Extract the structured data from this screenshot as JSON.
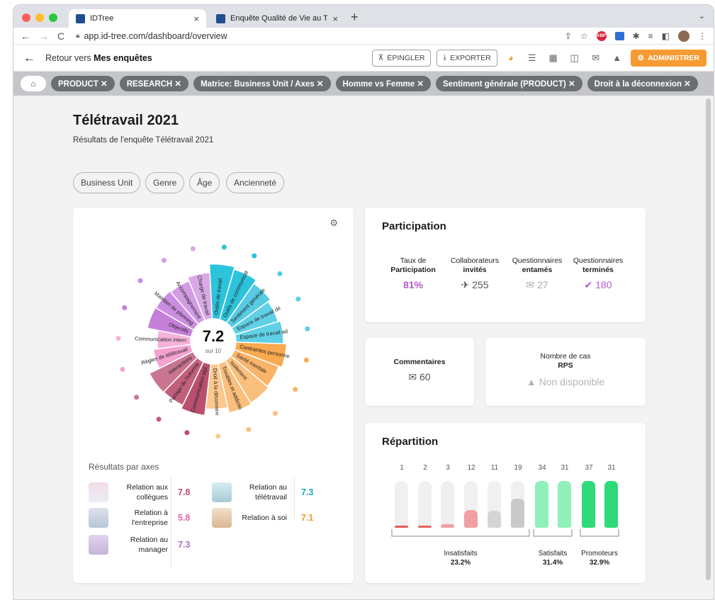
{
  "browser": {
    "tabs": [
      {
        "title": "IDTree",
        "close": "×"
      },
      {
        "title": "Enquête Qualité de Vie au Trav",
        "close": "×"
      }
    ],
    "new_tab": "+",
    "url": "app.id-tree.com/dashboard/overview"
  },
  "header": {
    "back_prefix": "Retour vers ",
    "back_target": "Mes enquêtes",
    "pin_label": "ÉPINGLER",
    "export_label": "EXPORTER",
    "admin_label": "ADMINISTRER"
  },
  "filters": [
    "PRODUCT ✕",
    "RESEARCH ✕",
    "Matrice: Business Unit / Axes ✕",
    "Homme vs Femme ✕",
    "Sentiment générale (PRODUCT) ✕",
    "Droit à la déconnexion ✕"
  ],
  "page": {
    "title": "Télétravail 2021",
    "subtitle": "Résultats de l'enquête Télétravail 2021",
    "segments": [
      "Business Unit",
      "Genre",
      "Âge",
      "Ancienneté"
    ]
  },
  "radial": {
    "score": "7.2",
    "score_sub": "sur 10",
    "items": [
      {
        "label": "Outils de travail",
        "value": 9.0,
        "color": "#2cc3dc"
      },
      {
        "label": "Outils de communicat",
        "value": 8.6,
        "color": "#2cc3dc"
      },
      {
        "label": "Sentiment générale",
        "value": 7.9,
        "color": "#56cbe3"
      },
      {
        "label": "Espace de travail dé",
        "value": 7.4,
        "color": "#5fd0e6"
      },
      {
        "label": "Espace de travail ad",
        "value": 7.8,
        "color": "#5fd0e6"
      },
      {
        "label": "Contraintes personne",
        "value": 8.3,
        "color": "#f9a94f"
      },
      {
        "label": "Santé mentale",
        "value": 7.8,
        "color": "#fab46a"
      },
      {
        "label": "Isolement",
        "value": 8.1,
        "color": "#fbbf7c"
      },
      {
        "label": "Troubles et addictio",
        "value": 8.3,
        "color": "#fbbf7c"
      },
      {
        "label": "Droit à la déconnexi",
        "value": 7.4,
        "color": "#fbc88d"
      },
      {
        "label": "Communication stpl",
        "value": 8.5,
        "color": "#b94f6e"
      },
      {
        "label": "Partage de l'informa",
        "value": 7.9,
        "color": "#c25f7c"
      },
      {
        "label": "Interactions",
        "value": 8.0,
        "color": "#c97590"
      },
      {
        "label": "Règles de télétravail",
        "value": 6.2,
        "color": "#f4a2d1"
      },
      {
        "label": "Communication intern",
        "value": 5.5,
        "color": "#f6b2db"
      },
      {
        "label": "Objectifs",
        "value": 7.3,
        "color": "#c47fd9"
      },
      {
        "label": "Maintien de planning",
        "value": 7.2,
        "color": "#cc8ee0"
      },
      {
        "label": "Accompagnement",
        "value": 7.0,
        "color": "#d29ce4"
      },
      {
        "label": "Charge de travail",
        "value": 7.6,
        "color": "#d9a9e7"
      }
    ]
  },
  "axes_title": "Résultats par axes",
  "axes": [
    {
      "label1": "Relation aux",
      "label2": "collègues",
      "value": "7.8",
      "color": "#b94f6e",
      "icon": "colleagues-illustration"
    },
    {
      "label1": "Relation à",
      "label2": "l'entreprise",
      "value": "5.8",
      "color": "#e864b4",
      "icon": "company-illustration"
    },
    {
      "label1": "Relation au",
      "label2": "manager",
      "value": "7.3",
      "color": "#b56bd0",
      "icon": "manager-illustration"
    },
    {
      "label1": "Relation au",
      "label2": "télétravail",
      "value": "7.3",
      "color": "#1ba7c7",
      "icon": "telework-illustration"
    },
    {
      "label1": "Relation à soi",
      "label2": "",
      "value": "7.1",
      "color": "#f59b32",
      "icon": "self-illustration"
    }
  ],
  "participation": {
    "title": "Participation",
    "stats": [
      {
        "l1": "Taux de",
        "l2": "Participation",
        "value": "81%",
        "icon": "",
        "color": "#b05acb"
      },
      {
        "l1": "Collaborateurs",
        "l2": "invités",
        "value": "255",
        "icon": "✈",
        "color": "#555555"
      },
      {
        "l1": "Questionnaires",
        "l2": "entamés",
        "value": "27",
        "icon": "✉",
        "color": "#aaaaaa"
      },
      {
        "l1": "Questionnaires",
        "l2": "terminés",
        "value": "180",
        "icon": "✔",
        "color": "#b05acb"
      }
    ]
  },
  "comments": {
    "title": "Commentaires",
    "value": "60"
  },
  "rps": {
    "title1": "Nombre de cas",
    "title2": "RPS",
    "value": "Non disponible"
  },
  "repartition": {
    "title": "Répartition",
    "bars": [
      {
        "label": "1",
        "fill": 0.03,
        "color": "#e85757"
      },
      {
        "label": "2",
        "fill": 0.05,
        "color": "#e86161"
      },
      {
        "label": "3",
        "fill": 0.08,
        "color": "#f0a0a0"
      },
      {
        "label": "12",
        "fill": 0.38,
        "color": "#f0a0a0"
      },
      {
        "label": "11",
        "fill": 0.36,
        "color": "#d5d5d5"
      },
      {
        "label": "19",
        "fill": 0.62,
        "color": "#c9c9c9"
      },
      {
        "label": "34",
        "fill": 1.0,
        "color": "#8ff0b9"
      },
      {
        "label": "31",
        "fill": 1.0,
        "color": "#8ff0b9"
      },
      {
        "label": "37",
        "fill": 1.0,
        "color": "#2edb78"
      },
      {
        "label": "31",
        "fill": 1.0,
        "color": "#2edb78"
      }
    ],
    "groups": [
      {
        "name": "Insatisfaits",
        "pct": "23.2%"
      },
      {
        "name": "Satisfaits",
        "pct": "31.4%"
      },
      {
        "name": "Promoteurs",
        "pct": "32.9%"
      }
    ]
  }
}
